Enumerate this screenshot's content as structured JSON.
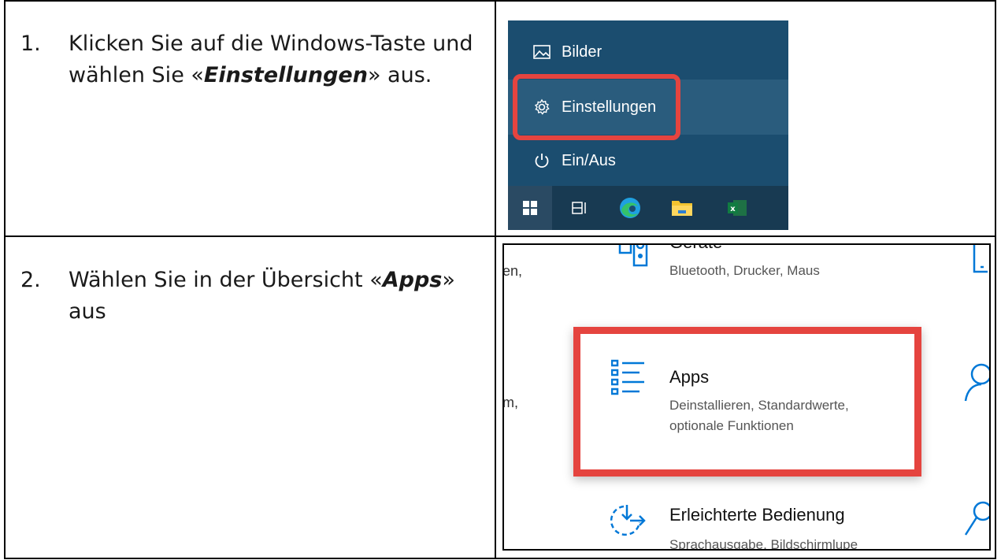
{
  "steps": [
    {
      "number": "1.",
      "text_before": "Klicken Sie auf die Windows-Taste und wählen Sie «",
      "text_bold": "Einstellungen",
      "text_after": "» aus."
    },
    {
      "number": "2.",
      "text_before": "Wählen Sie in der Übersicht «",
      "text_bold": "Apps",
      "text_after": "» aus"
    }
  ],
  "start_menu": {
    "items": [
      {
        "label": "Bilder",
        "icon": "pictures-icon"
      },
      {
        "label": "Einstellungen",
        "icon": "gear-icon",
        "highlighted": true
      },
      {
        "label": "Ein/Aus",
        "icon": "power-icon"
      }
    ],
    "taskbar": [
      "windows-start-icon",
      "task-view-icon",
      "edge-icon",
      "file-explorer-icon",
      "excel-icon"
    ],
    "colors": {
      "menu_bg": "#1b4d6f",
      "taskbar_bg": "#183a52",
      "highlight": "#e5443f"
    }
  },
  "settings": {
    "left_fragments": [
      "en,",
      "m,"
    ],
    "items": [
      {
        "title": "Geräte",
        "desc": "Bluetooth, Drucker, Maus",
        "icon": "devices-icon"
      },
      {
        "title": "Apps",
        "desc_line1": "Deinstallieren, Standardwerte,",
        "desc_line2": "optionale Funktionen",
        "icon": "apps-list-icon",
        "highlighted": true
      },
      {
        "title": "Erleichterte Bedienung",
        "desc": "Sprachausgabe, Bildschirmlupe",
        "icon": "ease-of-access-icon"
      }
    ],
    "accent_color": "#0078d7"
  }
}
